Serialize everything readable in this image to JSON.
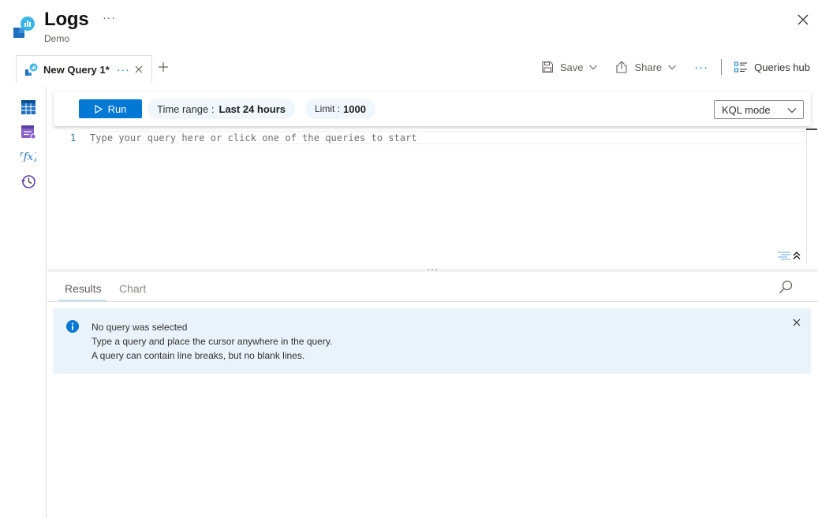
{
  "header": {
    "title": "Logs",
    "subtitle": "Demo",
    "more_label": "···",
    "logo_icon": "log-analytics-icon",
    "close_icon": "close-icon"
  },
  "tabs": [
    {
      "label": "New Query 1*",
      "icon": "query-tab-icon",
      "more_label": "···",
      "active": true
    }
  ],
  "toolbar": {
    "save_label": "Save",
    "share_label": "Share",
    "more_label": "···",
    "queries_hub_label": "Queries hub"
  },
  "rail": {
    "items": [
      {
        "icon": "tables-icon"
      },
      {
        "icon": "queries-icon"
      },
      {
        "icon": "functions-icon"
      },
      {
        "icon": "history-icon"
      }
    ]
  },
  "query_bar": {
    "run_label": "Run",
    "time_range_prefix": "Time range :",
    "time_range_value": "Last 24 hours",
    "limit_prefix": "Limit :",
    "limit_value": "1000",
    "mode_value": "KQL mode"
  },
  "editor": {
    "line_number": "1",
    "placeholder": "Type your query here or click one of the queries to start"
  },
  "splitter_label": "···",
  "results": {
    "tabs": [
      {
        "label": "Results",
        "active": true
      },
      {
        "label": "Chart",
        "active": false
      }
    ]
  },
  "info": {
    "title": "No query was selected",
    "line1": "Type a query and place the cursor anywhere in the query.",
    "line2": "A query can contain line breaks, but no blank lines."
  },
  "colors": {
    "accent": "#0078d4",
    "info_bg": "#eaf3fb",
    "pill_bg": "#eff6fc"
  }
}
